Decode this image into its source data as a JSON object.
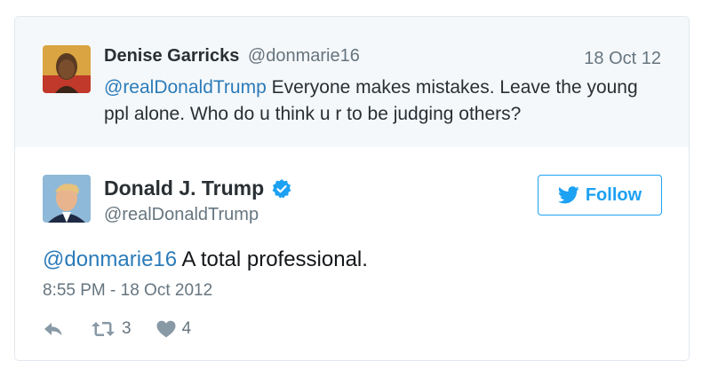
{
  "parent_tweet": {
    "author_name": "Denise Garricks",
    "author_handle": "@donmarie16",
    "date": "18 Oct 12",
    "mention": "@realDonaldTrump",
    "text": " Everyone makes mistakes. Leave the young ppl alone. Who do u think u r to be judging others?"
  },
  "tweet": {
    "author_name": "Donald J. Trump",
    "author_handle": "@realDonaldTrump",
    "follow_label": "Follow",
    "mention": "@donmarie16",
    "text": " A total professional.",
    "timestamp": "8:55 PM - 18 Oct 2012",
    "retweets": "3",
    "likes": "4"
  },
  "icons": {
    "verified": "verified-badge-icon",
    "bird": "twitter-bird-icon",
    "reply": "reply-icon",
    "retweet": "retweet-icon",
    "like": "heart-icon"
  },
  "colors": {
    "link": "#2b7bb9",
    "accent": "#1da1f2",
    "muted": "#66757f",
    "parent_bg": "#f5f8fa"
  }
}
